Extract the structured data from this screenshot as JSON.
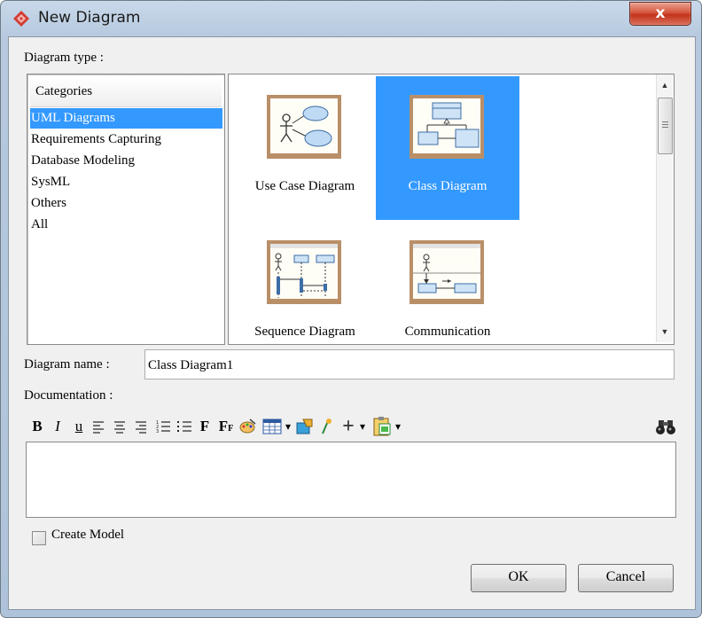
{
  "window": {
    "title": "New Diagram",
    "close_label": "x"
  },
  "labels": {
    "diagram_type": "Diagram type :",
    "diagram_name": "Diagram name :",
    "documentation": "Documentation :",
    "create_model": "Create Model"
  },
  "categories": {
    "header": "Categories",
    "items": [
      "UML Diagrams",
      "Requirements Capturing",
      "Database Modeling",
      "SysML",
      "Others",
      "All"
    ],
    "selected": "UML Diagrams"
  },
  "diagram_types": [
    {
      "label": "Use Case Diagram",
      "icon": "use-case-diagram-icon",
      "selected": false
    },
    {
      "label": "Class Diagram",
      "icon": "class-diagram-icon",
      "selected": true
    },
    {
      "label": "Sequence Diagram",
      "icon": "sequence-diagram-icon",
      "selected": false
    },
    {
      "label": "Communication",
      "icon": "communication-diagram-icon",
      "selected": false
    }
  ],
  "diagram_name_value": "Class Diagram1",
  "toolbar": {
    "bold": "B",
    "italic": "I",
    "underline": "u",
    "font": "F",
    "font_size": "F",
    "font_size_sub": "F",
    "insert_plus": "+",
    "dropdown": "▾"
  },
  "buttons": {
    "ok": "OK",
    "cancel": "Cancel"
  },
  "colors": {
    "selection": "#3399ff",
    "title_bar": "#b9cce0",
    "close_button": "#c9452e"
  }
}
